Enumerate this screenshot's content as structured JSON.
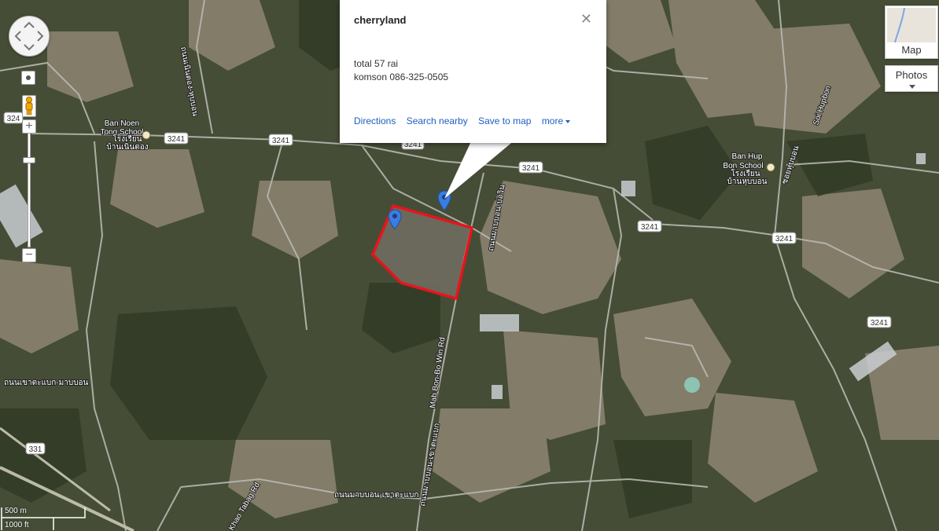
{
  "info_window": {
    "title": "cherryland",
    "line1": "total 57 rai",
    "line2": "komson 086-325-0505",
    "actions": [
      "Directions",
      "Search nearby",
      "Save to map",
      "more"
    ],
    "close_icon": "close-icon"
  },
  "map_type": {
    "label": "Map"
  },
  "photos": {
    "label": "Photos"
  },
  "scale": {
    "metric": "500 m",
    "imperial": "1000 ft"
  },
  "map_labels": {
    "place1a": "Ban Noen",
    "place1b": "Tong School",
    "place1c": "โรงเรียน",
    "place1d": "บ้านเนินตอง",
    "place2a": "Ban Hup",
    "place2b": "Bon School",
    "place2c": "โรงเรียน",
    "place2d": "บ้านหุบบอน",
    "road_3241": "3241",
    "road_324": "324",
    "road_331": "331",
    "road_soi_hupbon": "Soi Hupbon",
    "road_soi_hupbon_th": "ซอยหุบบอน",
    "road_mab_bon": "Mab Bon-Bo Win Rd",
    "road_mab_bon_th": "ถนนมาบบอน-บ่อวิน",
    "road_khao_tabag": "Khao Tabag Rd",
    "road_bottom_th": "ถนนมาบบอน-เขาตะแบก",
    "road_left_th": "ถนนเขาตะแบก-มาบบอน",
    "road_top_th": "ถนนเนินตอง-หุบบอน"
  },
  "colors": {
    "polygon": "#e8141c",
    "marker": "#3b7de0"
  }
}
